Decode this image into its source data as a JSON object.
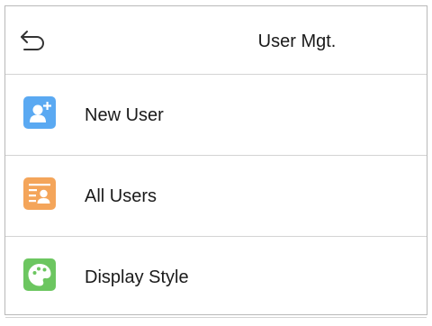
{
  "header": {
    "title": "User Mgt.",
    "back_icon": "back-arrow-icon"
  },
  "menu": {
    "items": [
      {
        "label": "New User",
        "icon": "add-user-icon",
        "color": "#5aa9f2"
      },
      {
        "label": "All Users",
        "icon": "user-list-icon",
        "color": "#f4a55a"
      },
      {
        "label": "Display Style",
        "icon": "palette-icon",
        "color": "#6cc660"
      }
    ]
  },
  "colors": {
    "divider": "#d4d4d4",
    "text": "#1a1a1a",
    "background": "#ffffff"
  }
}
